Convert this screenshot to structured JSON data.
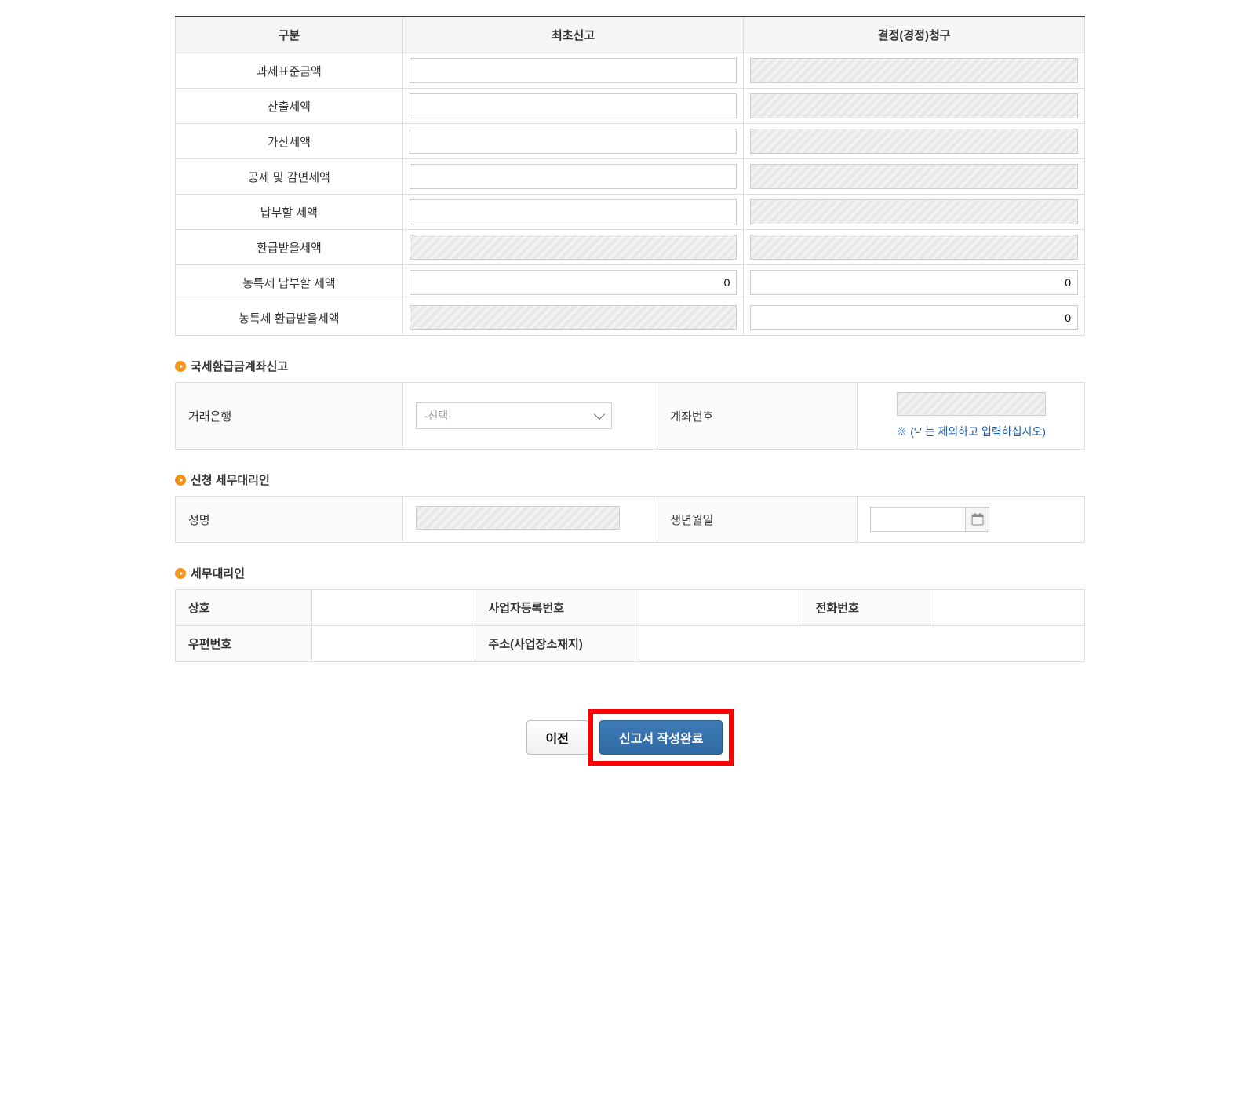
{
  "mainTable": {
    "headers": {
      "col0": "구분",
      "col1": "최초신고",
      "col2": "결정(경정)청구"
    },
    "rows": {
      "r1": {
        "label": "과세표준금액",
        "v1": "",
        "v2": ""
      },
      "r2": {
        "label": "산출세액",
        "v1": "",
        "v2": ""
      },
      "r3": {
        "label": "가산세액",
        "v1": "",
        "v2": ""
      },
      "r4": {
        "label": "공제 및 감면세액",
        "v1": "",
        "v2": ""
      },
      "r5": {
        "label": "납부할 세액",
        "v1": "",
        "v2": ""
      },
      "r6": {
        "label": "환급받을세액",
        "v1": "",
        "v2": ""
      },
      "r7": {
        "label": "농특세 납부할 세액",
        "v1": "0",
        "v2": "0"
      },
      "r8": {
        "label": "농특세 환급받을세액",
        "v1": "",
        "v2": "0"
      }
    }
  },
  "sections": {
    "refund": {
      "title": "국세환급금계좌신고",
      "bankLabel": "거래은행",
      "bankPlaceholder": "-선택-",
      "accountLabel": "계좌번호",
      "accountNote": "※ ('-' 는 제외하고 입력하십시오)"
    },
    "applicant": {
      "title": "신청 세무대리인",
      "nameLabel": "성명",
      "dobLabel": "생년월일"
    },
    "agent": {
      "title": "세무대리인",
      "companyLabel": "상호",
      "regnoLabel": "사업자등록번호",
      "phoneLabel": "전화번호",
      "zipLabel": "우편번호",
      "addressLabel": "주소(사업장소재지)"
    }
  },
  "buttons": {
    "prev": "이전",
    "complete": "신고서 작성완료"
  }
}
